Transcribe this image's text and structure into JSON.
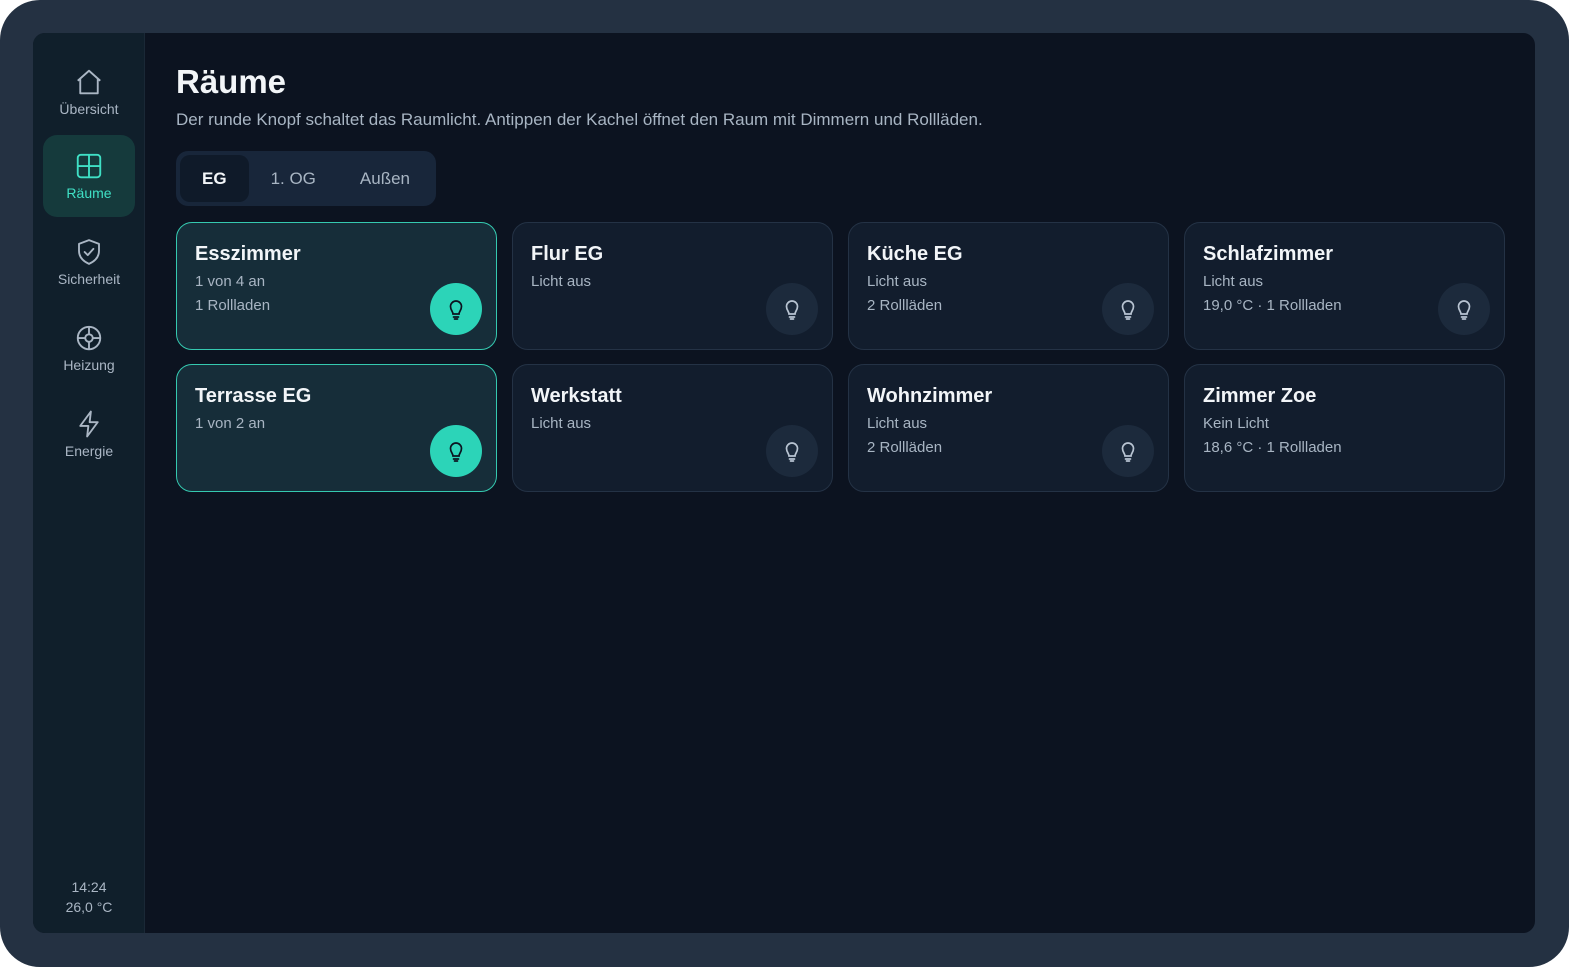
{
  "sidebar": {
    "items": [
      {
        "label": "Übersicht",
        "icon": "home-icon"
      },
      {
        "label": "Räume",
        "icon": "rooms-grid-icon",
        "active": true
      },
      {
        "label": "Sicherheit",
        "icon": "shield-check-icon"
      },
      {
        "label": "Heizung",
        "icon": "heating-icon"
      },
      {
        "label": "Energie",
        "icon": "lightning-icon"
      }
    ],
    "time": "14:24",
    "temperature": "26,0 °C"
  },
  "page": {
    "title": "Räume",
    "subtitle": "Der runde Knopf schaltet das Raumlicht. Antippen der Kachel öffnet den Raum mit Dimmern und Rollläden."
  },
  "floor_tabs": [
    {
      "label": "EG",
      "active": true
    },
    {
      "label": "1. OG"
    },
    {
      "label": "Außen"
    }
  ],
  "rooms": [
    {
      "name": "Esszimmer",
      "line1": "1 von 4 an",
      "line2": "1 Rollladen",
      "light_on": true
    },
    {
      "name": "Flur EG",
      "line1": "Licht aus",
      "line2": "",
      "light_on": false
    },
    {
      "name": "Küche EG",
      "line1": "Licht aus",
      "line2": "2 Rollläden",
      "light_on": false
    },
    {
      "name": "Schlafzimmer",
      "line1": "Licht aus",
      "line2": "19,0 °C · 1 Rollladen",
      "light_on": false
    },
    {
      "name": "Terrasse EG",
      "line1": "1 von 2 an",
      "line2": "",
      "light_on": true
    },
    {
      "name": "Werkstatt",
      "line1": "Licht aus",
      "line2": "",
      "light_on": false
    },
    {
      "name": "Wohnzimmer",
      "line1": "Licht aus",
      "line2": "2 Rollläden",
      "light_on": false
    },
    {
      "name": "Zimmer Zoe",
      "line1": "Kein Licht",
      "line2": "18,6 °C · 1 Rollladen",
      "has_light": false
    }
  ],
  "colors": {
    "accent": "#2cd4b8",
    "background": "#0c1320",
    "tile": "#121d2d",
    "tile_on": "#162d39"
  }
}
